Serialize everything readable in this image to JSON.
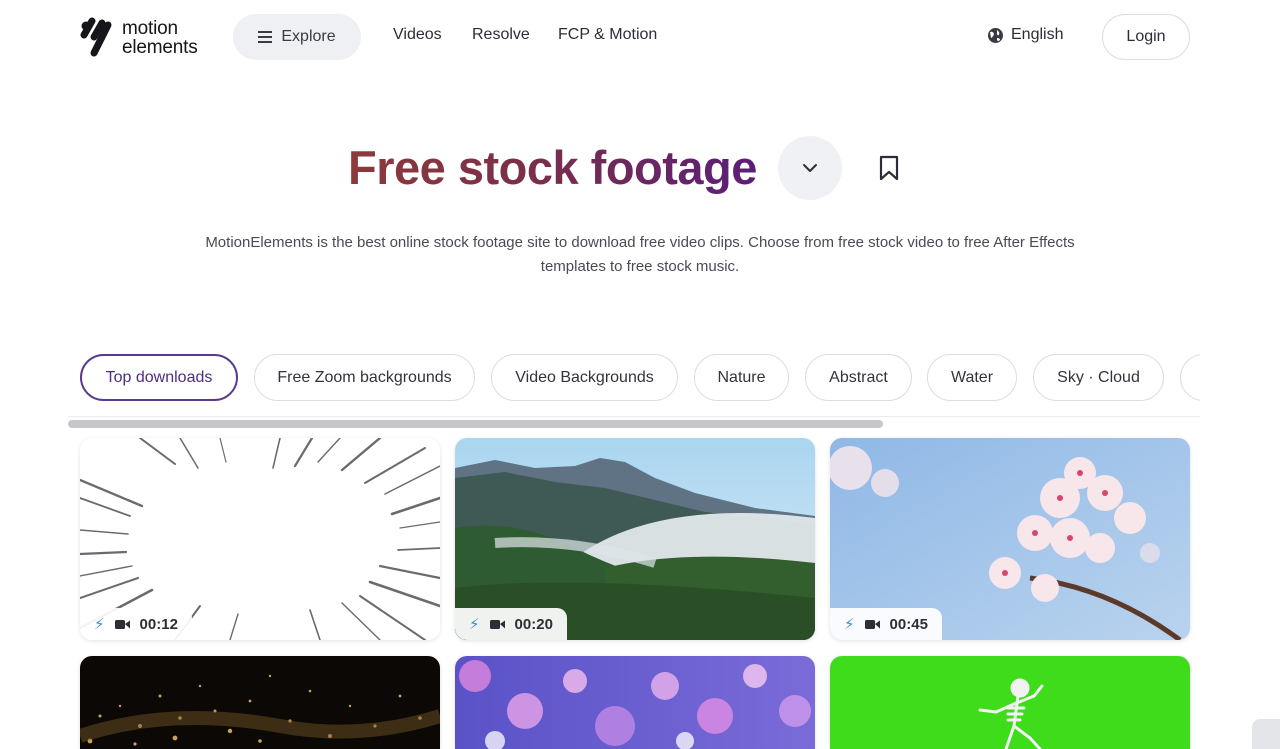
{
  "header": {
    "logo_text": "motion\nelements",
    "explore_label": "Explore",
    "nav_links": [
      "Videos",
      "Resolve",
      "FCP & Motion"
    ],
    "language_label": "English",
    "login_label": "Login"
  },
  "hero": {
    "title": "Free stock footage",
    "description": "MotionElements is the best online stock footage site to download free video clips. Choose from free stock video to free After Effects templates to free stock music."
  },
  "chips": [
    "Top downloads",
    "Free Zoom backgrounds",
    "Video Backgrounds",
    "Nature",
    "Abstract",
    "Water",
    "Sky · Cloud"
  ],
  "active_chip": "Top downloads",
  "clips": [
    {
      "duration": "00:12",
      "subject": "speed-lines"
    },
    {
      "duration": "00:20",
      "subject": "mountain-fog"
    },
    {
      "duration": "00:45",
      "subject": "cherry-blossom"
    },
    {
      "subject": "gold-particles"
    },
    {
      "subject": "bokeh-lights"
    },
    {
      "subject": "green-screen-skeleton"
    }
  ],
  "colors": {
    "accent": "#5a3a8f",
    "title_gradient_start": "#8d3a3a",
    "title_gradient_end": "#5a1e78",
    "bolt": "#3a8fd8",
    "green_screen": "#3fdc1b"
  }
}
